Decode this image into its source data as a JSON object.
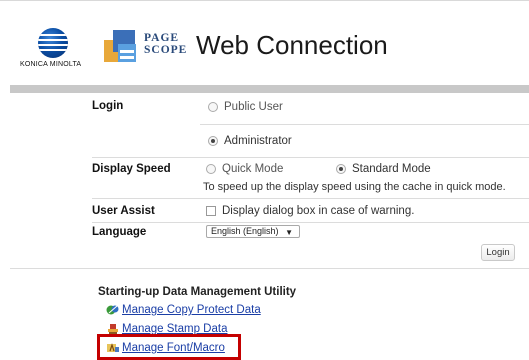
{
  "header": {
    "brand_text": "KONICA MINOLTA",
    "logo_text_line1": "PAGE",
    "logo_text_line2": "SCOPE",
    "product_title": "Web Connection"
  },
  "login": {
    "label": "Login",
    "options": [
      "Public User",
      "Administrator"
    ],
    "selected": "Administrator"
  },
  "display_speed": {
    "label": "Display Speed",
    "options": [
      "Quick Mode",
      "Standard Mode"
    ],
    "selected": "Standard Mode",
    "hint": "To speed up the display speed using the cache in quick mode."
  },
  "user_assist": {
    "label": "User Assist",
    "checkbox_label": "Display dialog box in case of warning.",
    "checked": false
  },
  "language": {
    "label": "Language",
    "selected": "English (English)"
  },
  "login_button": "Login",
  "utilities": {
    "title": "Starting-up Data Management Utility",
    "links": [
      {
        "label": "Manage Copy Protect Data",
        "icon": "copy-protect-icon"
      },
      {
        "label": "Manage Stamp Data",
        "icon": "stamp-icon"
      },
      {
        "label": "Manage Font/Macro",
        "icon": "font-macro-icon"
      }
    ]
  },
  "colors": {
    "link": "#1a3ea6",
    "highlight_border": "#c40000",
    "header_bar": "#c8c8c8"
  }
}
